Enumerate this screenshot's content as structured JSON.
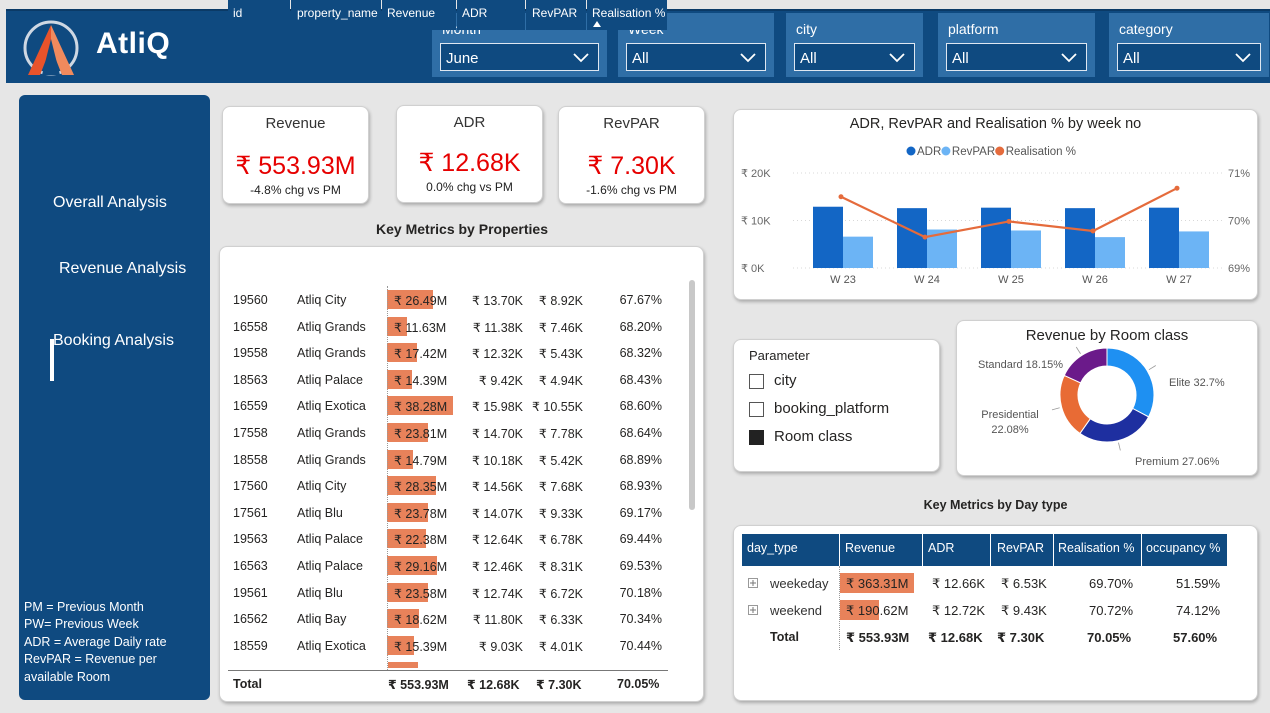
{
  "header": {
    "brand": "AtliQ",
    "filters": [
      {
        "label": "Month",
        "value": "June"
      },
      {
        "label": "Week",
        "value": "All"
      },
      {
        "label": "city",
        "value": "All"
      },
      {
        "label": "platform",
        "value": "All"
      },
      {
        "label": "category",
        "value": "All"
      }
    ]
  },
  "sidebar": {
    "items": [
      {
        "label": "Overall Analysis"
      },
      {
        "label": "Revenue Analysis"
      },
      {
        "label": "Booking Analysis"
      }
    ],
    "notes": [
      "PM = Previous Month",
      "PW= Previous Week",
      "ADR = Average Daily rate",
      "RevPAR = Revenue per",
      "available Room"
    ]
  },
  "kpis": [
    {
      "title": "Revenue",
      "value": "₹ 553.93M",
      "sub": "-4.8% chg vs PM"
    },
    {
      "title": "ADR",
      "value": "₹ 12.68K",
      "sub": "0.0% chg vs PM"
    },
    {
      "title": "RevPAR",
      "value": "₹ 7.30K",
      "sub": "-1.6% chg vs PM"
    }
  ],
  "properties": {
    "title": "Key Metrics by Properties",
    "columns": [
      "id",
      "property_name",
      "Revenue",
      "ADR",
      "RevPAR",
      "Realisation %"
    ],
    "rows": [
      {
        "id": "19560",
        "name": "Atliq City",
        "revenue": "₹ 26.49M",
        "rev_value": 26.49,
        "adr": "₹ 13.70K",
        "revpar": "₹ 8.92K",
        "real": "67.67%"
      },
      {
        "id": "16558",
        "name": "Atliq Grands",
        "revenue": "₹ 11.63M",
        "rev_value": 11.63,
        "adr": "₹ 11.38K",
        "revpar": "₹ 7.46K",
        "real": "68.20%"
      },
      {
        "id": "19558",
        "name": "Atliq Grands",
        "revenue": "₹ 17.42M",
        "rev_value": 17.42,
        "adr": "₹ 12.32K",
        "revpar": "₹ 5.43K",
        "real": "68.32%"
      },
      {
        "id": "18563",
        "name": "Atliq Palace",
        "revenue": "₹ 14.39M",
        "rev_value": 14.39,
        "adr": "₹ 9.42K",
        "revpar": "₹ 4.94K",
        "real": "68.43%"
      },
      {
        "id": "16559",
        "name": "Atliq Exotica",
        "revenue": "₹ 38.28M",
        "rev_value": 38.28,
        "adr": "₹ 15.98K",
        "revpar": "₹ 10.55K",
        "real": "68.60%"
      },
      {
        "id": "17558",
        "name": "Atliq Grands",
        "revenue": "₹ 23.81M",
        "rev_value": 23.81,
        "adr": "₹ 14.70K",
        "revpar": "₹ 7.78K",
        "real": "68.64%"
      },
      {
        "id": "18558",
        "name": "Atliq Grands",
        "revenue": "₹ 14.79M",
        "rev_value": 14.79,
        "adr": "₹ 10.18K",
        "revpar": "₹ 5.42K",
        "real": "68.89%"
      },
      {
        "id": "17560",
        "name": "Atliq City",
        "revenue": "₹ 28.35M",
        "rev_value": 28.35,
        "adr": "₹ 14.56K",
        "revpar": "₹ 7.68K",
        "real": "68.93%"
      },
      {
        "id": "17561",
        "name": "Atliq Blu",
        "revenue": "₹ 23.78M",
        "rev_value": 23.78,
        "adr": "₹ 14.07K",
        "revpar": "₹ 9.33K",
        "real": "69.17%"
      },
      {
        "id": "19563",
        "name": "Atliq Palace",
        "revenue": "₹ 22.38M",
        "rev_value": 22.38,
        "adr": "₹ 12.64K",
        "revpar": "₹ 6.78K",
        "real": "69.44%"
      },
      {
        "id": "16563",
        "name": "Atliq Palace",
        "revenue": "₹ 29.16M",
        "rev_value": 29.16,
        "adr": "₹ 12.46K",
        "revpar": "₹ 8.31K",
        "real": "69.53%"
      },
      {
        "id": "19561",
        "name": "Atliq Blu",
        "revenue": "₹ 23.58M",
        "rev_value": 23.58,
        "adr": "₹ 12.74K",
        "revpar": "₹ 6.72K",
        "real": "70.18%"
      },
      {
        "id": "16562",
        "name": "Atliq Bay",
        "revenue": "₹ 18.62M",
        "rev_value": 18.62,
        "adr": "₹ 11.80K",
        "revpar": "₹ 6.33K",
        "real": "70.34%"
      },
      {
        "id": "18559",
        "name": "Atliq Exotica",
        "revenue": "₹ 15.39M",
        "rev_value": 15.39,
        "adr": "₹ 9.03K",
        "revpar": "₹ 4.01K",
        "real": "70.44%"
      }
    ],
    "total": {
      "label": "Total",
      "revenue": "₹ 553.93M",
      "adr": "₹ 12.68K",
      "revpar": "₹ 7.30K",
      "real": "70.05%"
    }
  },
  "weekly": {
    "title": "ADR, RevPAR and Realisation % by week no",
    "chart_data": {
      "type": "bar",
      "title": "ADR, RevPAR and Realisation % by week no",
      "categories": [
        "W 23",
        "W 24",
        "W 25",
        "W 26",
        "W 27"
      ],
      "series": [
        {
          "name": "ADR",
          "type": "bar",
          "color": "#1366c5",
          "values": [
            12.9,
            12.6,
            12.7,
            12.6,
            12.7
          ]
        },
        {
          "name": "RevPAR",
          "type": "bar",
          "color": "#6cb4f5",
          "values": [
            6.6,
            8.1,
            7.9,
            6.5,
            7.7
          ]
        },
        {
          "name": "Realisation %",
          "type": "line",
          "axis": "right",
          "color": "#e56b3c",
          "values": [
            70.5,
            69.65,
            69.98,
            69.78,
            70.68
          ]
        }
      ],
      "y_left": {
        "ticks": [
          "₹ 0K",
          "₹ 10K",
          "₹ 20K"
        ],
        "range": [
          0,
          20
        ]
      },
      "y_right": {
        "ticks": [
          "69%",
          "70%",
          "71%"
        ],
        "range": [
          69,
          71
        ]
      },
      "legend": "top"
    }
  },
  "parameter": {
    "title": "Parameter",
    "items": [
      {
        "label": "city",
        "checked": false
      },
      {
        "label": "booking_platform",
        "checked": false
      },
      {
        "label": "Room class",
        "checked": true
      }
    ]
  },
  "room_class": {
    "title": "Revenue by Room class",
    "chart_data": {
      "type": "pie",
      "title": "Revenue by Room class",
      "slices": [
        {
          "name": "Elite",
          "value": 32.7,
          "label": "Elite 32.7%",
          "color": "#1e90f2"
        },
        {
          "name": "Premium",
          "value": 27.06,
          "label": "Premium 27.06%",
          "color": "#1e2fa0"
        },
        {
          "name": "Presidential",
          "value": 22.08,
          "label": "Presidential 22.08%",
          "label_lines": [
            "Presidential",
            "22.08%"
          ],
          "color": "#e86b35"
        },
        {
          "name": "Standard",
          "value": 18.15,
          "label": "Standard 18.15%",
          "color": "#6b1a8a"
        }
      ]
    }
  },
  "daytype": {
    "title": "Key Metrics by Day type",
    "columns": [
      "day_type",
      "Revenue",
      "ADR",
      "RevPAR",
      "Realisation %",
      "occupancy %"
    ],
    "rows": [
      {
        "name": "weekeday",
        "revenue": "₹ 363.31M",
        "rev_value": 363.31,
        "adr": "₹ 12.66K",
        "revpar": "₹ 6.53K",
        "real": "69.70%",
        "occ": "51.59%"
      },
      {
        "name": "weekend",
        "revenue": "₹ 190.62M",
        "rev_value": 190.62,
        "adr": "₹ 12.72K",
        "revpar": "₹ 9.43K",
        "real": "70.72%",
        "occ": "74.12%"
      }
    ],
    "total": {
      "label": "Total",
      "revenue": "₹ 553.93M",
      "adr": "₹ 12.68K",
      "revpar": "₹ 7.30K",
      "real": "70.05%",
      "occ": "57.60%"
    }
  }
}
